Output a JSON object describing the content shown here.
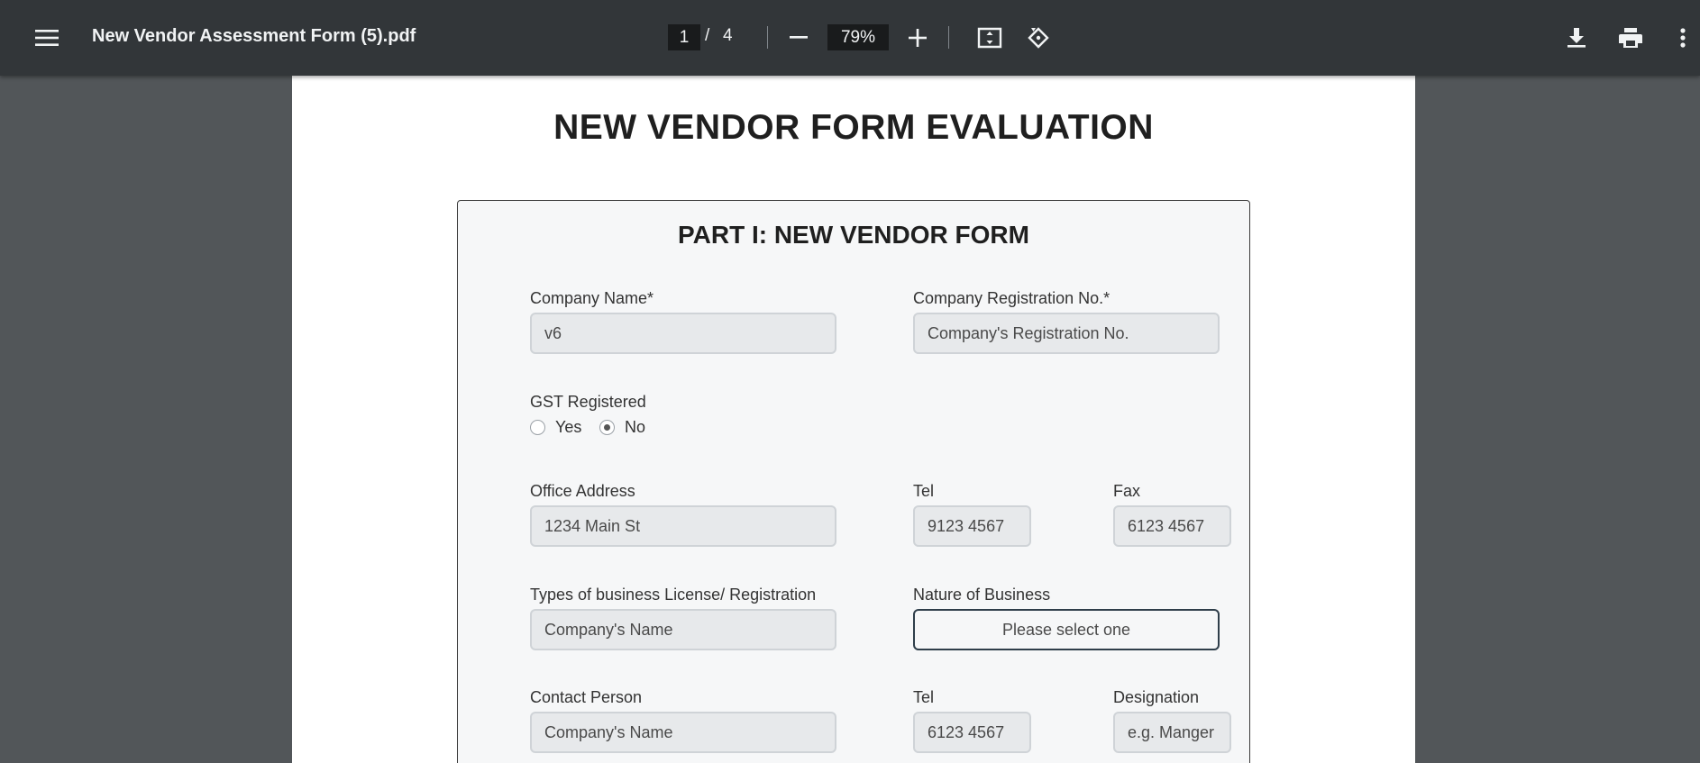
{
  "toolbar": {
    "menu_icon": "hamburger-menu-icon",
    "title": "New Vendor Assessment Form (5).pdf",
    "page_current": "1",
    "page_separator": "/",
    "page_total": "4",
    "zoom_level": "79%",
    "icons": [
      "minus-icon",
      "plus-icon",
      "fit-page-icon",
      "rotate-icon",
      "download-icon",
      "print-icon",
      "more-vert-icon"
    ]
  },
  "document": {
    "title": "NEW VENDOR FORM EVALUATION",
    "part_title": "PART I: NEW VENDOR FORM",
    "company_name": {
      "label": "Company Name*",
      "value": "v6"
    },
    "company_reg": {
      "label": "Company Registration No.*",
      "placeholder": "Company's Registration No."
    },
    "gst": {
      "label": "GST Registered",
      "yes": "Yes",
      "no": "No",
      "selected": "No"
    },
    "office_address": {
      "label": "Office Address",
      "value": "1234 Main St"
    },
    "tel1": {
      "label": "Tel",
      "value": "9123 4567"
    },
    "fax": {
      "label": "Fax",
      "value": "6123 4567"
    },
    "license": {
      "label": "Types of business License/ Registration",
      "placeholder": "Company's Name"
    },
    "nature": {
      "label": "Nature of Business",
      "value": "Please select one"
    },
    "contact_person": {
      "label": "Contact Person",
      "placeholder": "Company's Name"
    },
    "tel2": {
      "label": "Tel",
      "value": "6123 4567"
    },
    "designation": {
      "label": "Designation",
      "placeholder": "e.g. Manger"
    }
  },
  "colors": {
    "toolbar_bg": "#323639",
    "viewer_bg": "#525659",
    "form_bg": "#f6f7f8",
    "field_bg": "#e7e9eb"
  }
}
